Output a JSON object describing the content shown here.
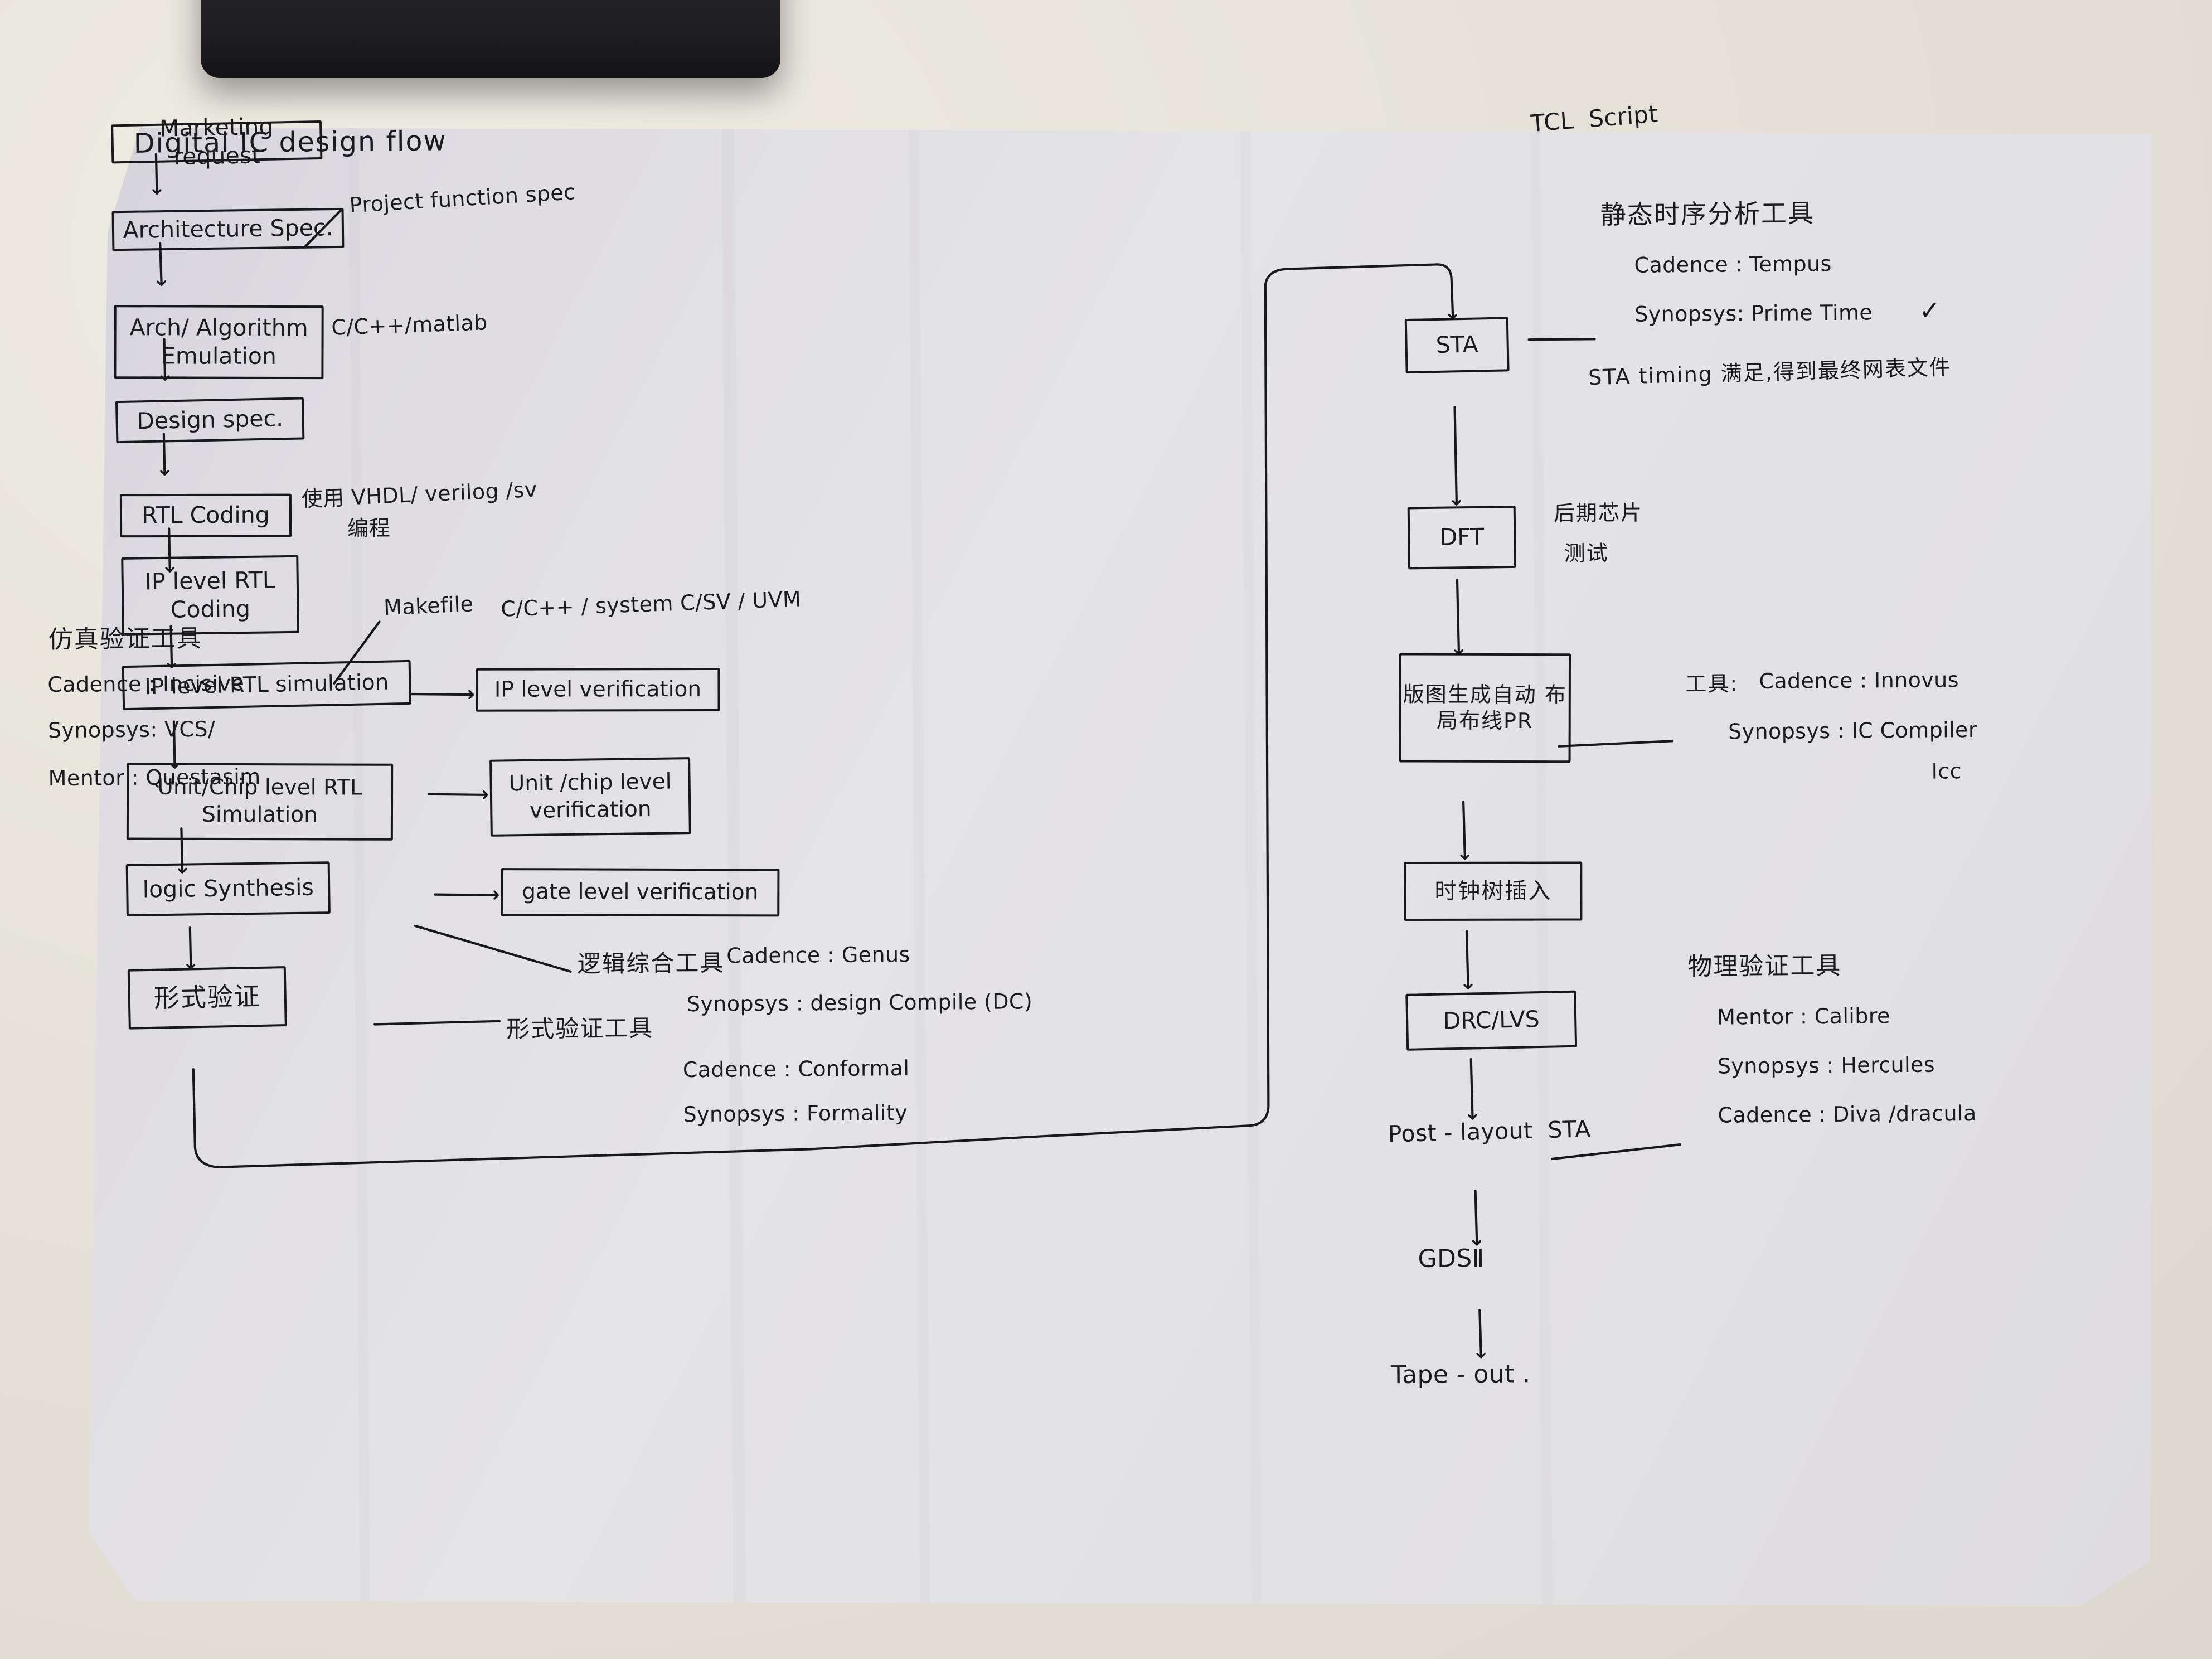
{
  "title": "Digital IC design flow",
  "left_column": {
    "boxes": [
      {
        "id": "marketing-request",
        "label": "Marketing request"
      },
      {
        "id": "architecture-spec",
        "label": "Architecture Spec."
      },
      {
        "id": "arch-algorithm-emulation",
        "label": "Arch/ Algorithm\nEmulation"
      },
      {
        "id": "design-spec",
        "label": "Design  spec."
      },
      {
        "id": "rtl-coding",
        "label": "RTL Coding"
      },
      {
        "id": "ip-level-rtl-coding",
        "label": "IP level RTL\nCoding"
      },
      {
        "id": "ip-level-rtl-simulation",
        "label": "IP level RTL simulation"
      },
      {
        "id": "unit-chip-level-rtl-simulation",
        "label": "Unit/Chip level RTL\nSimulation"
      },
      {
        "id": "logic-synthesis",
        "label": "logic Synthesis"
      },
      {
        "id": "formal-verification",
        "label": "形式验证"
      }
    ],
    "side_boxes": [
      {
        "id": "ip-level-verification",
        "label": "IP level verification"
      },
      {
        "id": "unit-chip-level-verification",
        "label": "Unit /chip level\nverification"
      },
      {
        "id": "gate-level-verification",
        "label": "gate level verification"
      }
    ],
    "annotations": {
      "project_function_spec": "Project function spec",
      "c_cpp_matlab": "C/C++/matlab",
      "hdl_languages": "使用 VHDL/ verilog /sv",
      "hdl_languages_line2": "编程",
      "makefile": "Makefile",
      "verification_languages": "C/C++ / system C/SV / UVM"
    },
    "sim_tools": {
      "heading": "仿真验证工具",
      "items": [
        "Cadence : Incisive",
        "Synopsys: VCS/",
        "Mentor : Questasim"
      ]
    },
    "synth_tools": {
      "heading": "逻辑综合工具",
      "items": [
        "Cadence : Genus",
        "Synopsys : design Compile (DC)"
      ]
    },
    "formal_tools": {
      "heading": "形式验证工具",
      "items": [
        "Cadence : Conformal",
        "Synopsys : Formality"
      ]
    }
  },
  "right_column": {
    "boxes": [
      {
        "id": "sta",
        "label": "STA"
      },
      {
        "id": "dft",
        "label": "DFT"
      },
      {
        "id": "place-route-pr",
        "label": "版图生成自动\n布局布线PR"
      },
      {
        "id": "clock-tree-insertion",
        "label": "时钟树插入"
      },
      {
        "id": "drc-lvs",
        "label": "DRC/LVS"
      }
    ],
    "plain_steps": [
      {
        "id": "post-layout-sta",
        "label": "Post - layout  STA"
      },
      {
        "id": "gdsii",
        "label": "GDSⅡ"
      },
      {
        "id": "tape-out",
        "label": "Tape - out ."
      }
    ],
    "annotations": {
      "tcl_script": "TCL  Script",
      "dft_note_line1": "后期芯片",
      "dft_note_line2": "测试",
      "sta_timing_note": "STA timing 满足,得到最终网表文件",
      "prime_time_check": "✓"
    },
    "sta_tools": {
      "heading": "静态时序分析工具",
      "items": [
        "Cadence : Tempus",
        "Synopsys: Prime Time"
      ]
    },
    "pr_tools": {
      "heading": "工具:",
      "items": [
        "Cadence : Innovus",
        "Synopsys : IC Compiler",
        "Icc"
      ]
    },
    "physical_tools": {
      "heading": "物理验证工具",
      "items": [
        "Mentor : Calibre",
        "Synopsys : Hercules",
        "Cadence : Diva /dracula"
      ]
    }
  },
  "colors": {
    "ink": "#1b1b1f",
    "paper": "#e0dee3",
    "desk": "#e7e3da",
    "dark_object": "#1e1e20"
  }
}
